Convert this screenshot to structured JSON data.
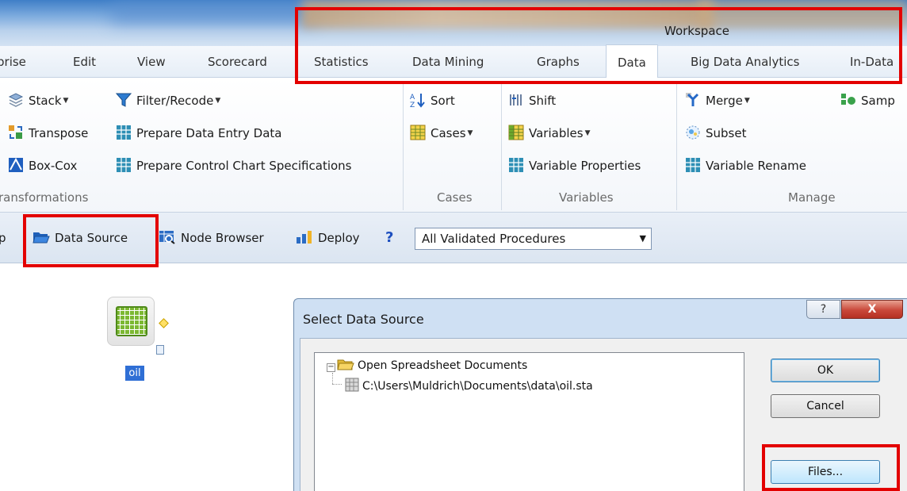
{
  "workspace_label": "Workspace",
  "tabs": [
    "prise",
    "Edit",
    "View",
    "Scorecard",
    "Statistics",
    "Data Mining",
    "Graphs",
    "Data",
    "Big Data Analytics",
    "In-Data"
  ],
  "ribbon": {
    "stack": "Stack",
    "filter_recode": "Filter/Recode",
    "transpose": "Transpose",
    "prepare_data_entry": "Prepare Data Entry Data",
    "box_cox": "Box-Cox",
    "prepare_control_chart": "Prepare Control Chart Specifications",
    "sort": "Sort",
    "cases": "Cases",
    "shift": "Shift",
    "variables": "Variables",
    "variable_properties": "Variable Properties",
    "merge": "Merge",
    "subset": "Subset",
    "variable_rename": "Variable Rename",
    "sample": "Samp",
    "groups": {
      "transformations": "ransformations",
      "cases": "Cases",
      "variables": "Variables",
      "manage": "Manage"
    }
  },
  "toolbar": {
    "edge_char": "p",
    "data_source": "Data Source",
    "node_browser": "Node Browser",
    "deploy": "Deploy",
    "help": "?",
    "procedures_selected": "All Validated Procedures"
  },
  "node": {
    "label": "oil"
  },
  "dialog": {
    "title": "Select Data Source",
    "help": "?",
    "close": "X",
    "tree_root": "Open Spreadsheet Documents",
    "tree_child": "C:\\Users\\Muldrich\\Documents\\data\\oil.sta",
    "ok": "OK",
    "cancel": "Cancel",
    "files": "Files..."
  },
  "colors": {
    "highlight": "#e30000",
    "title_bar": "#cfe0f3",
    "node_green": "#7cb832"
  }
}
